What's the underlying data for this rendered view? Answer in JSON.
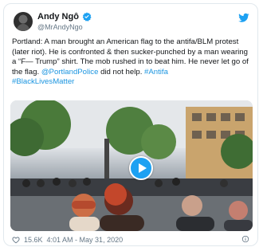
{
  "tweet": {
    "author_name": "Andy Ngô",
    "author_handle": "@MrAndyNgo",
    "text_part1": "Portland: A man brought an American flag to the antifa/BLM protest (later riot). He is confronted & then sucker-punched by a man wearing a “F— Trump” shirt. The mob rushed in to beat him. He never let go of the flag. ",
    "mention": "@PortlandPolice",
    "text_part2": " did not help. ",
    "hashtag1": "#Antifa",
    "hashtag2": "#BlackLivesMatter",
    "likes": "15.6K",
    "timestamp": "4:01 AM - May 31, 2020"
  },
  "icons": {
    "verified": "verified-badge-icon",
    "twitter": "twitter-bird-icon",
    "play": "play-icon",
    "heart": "heart-icon",
    "info": "info-icon"
  },
  "colors": {
    "accent": "#1da1f2",
    "link": "#1b95e0",
    "text": "#14171a",
    "muted": "#657786"
  }
}
